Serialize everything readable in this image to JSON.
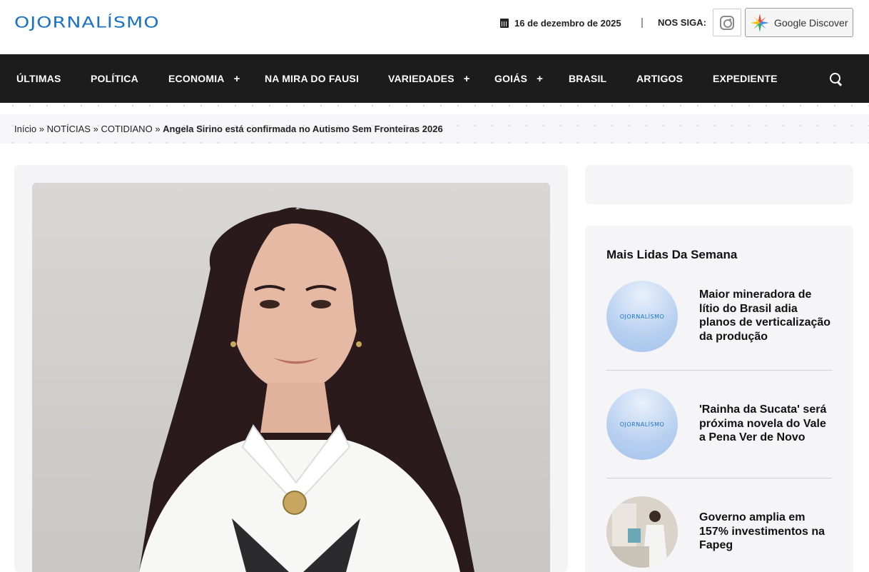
{
  "header": {
    "logo": "OJORNALÍSMO",
    "date": "16 de dezembro de 2025",
    "separator": "|",
    "follow_label": "NOS SIGA:",
    "google_discover": "Google Discover"
  },
  "nav": {
    "items": [
      {
        "label": "ÚLTIMAS",
        "submenu": false
      },
      {
        "label": "POLÍTICA",
        "submenu": false
      },
      {
        "label": "ECONOMIA",
        "submenu": true
      },
      {
        "label": "NA MIRA DO FAUSI",
        "submenu": false
      },
      {
        "label": "VARIEDADES",
        "submenu": true
      },
      {
        "label": "GOIÁS",
        "submenu": true
      },
      {
        "label": "BRASIL",
        "submenu": false
      },
      {
        "label": "ARTIGOS",
        "submenu": false
      },
      {
        "label": "EXPEDIENTE",
        "submenu": false
      }
    ],
    "plus": "+"
  },
  "breadcrumb": {
    "home": "Início",
    "sep": "»",
    "level1": "NOTÍCIAS",
    "level2": "COTIDIANO",
    "current": "Angela Sirino está confirmada no Autismo Sem Fronteiras 2026"
  },
  "sidebar": {
    "title": "Mais Lidas Da Semana",
    "items": [
      {
        "title": "Maior mineradora de lítio do Brasil adia planos de verticalização da produção",
        "thumb_text": "OJORNALÍSMO"
      },
      {
        "title": "'Rainha da Sucata' será próxima novela do Vale a Pena Ver de Novo",
        "thumb_text": "OJORNALÍSMO"
      },
      {
        "title": "Governo amplia em 157% investimentos na Fapeg",
        "thumb_text": ""
      }
    ]
  },
  "colors": {
    "brand": "#1a73c6",
    "nav_bg": "#1c1c1c"
  }
}
